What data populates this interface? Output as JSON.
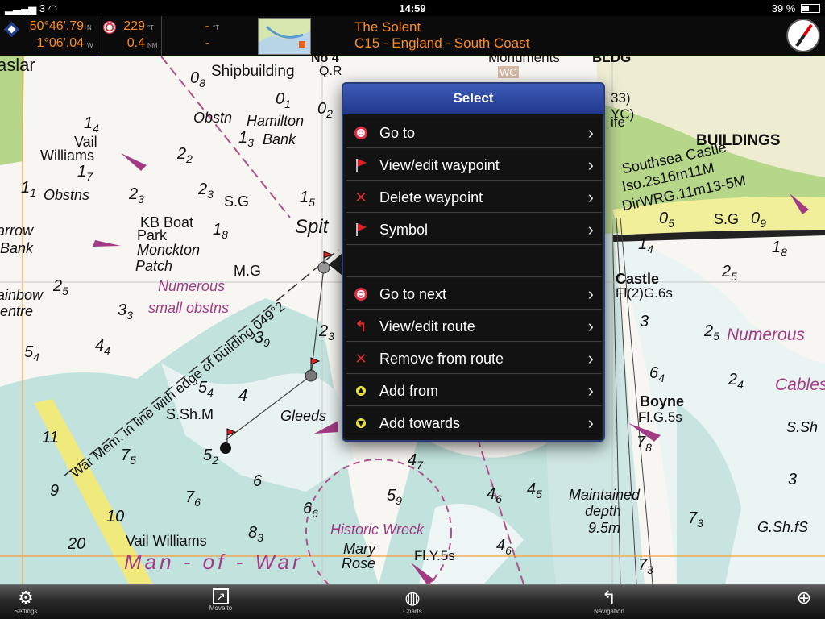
{
  "status_bar": {
    "carrier": "3",
    "time": "14:59",
    "battery": "39 %"
  },
  "info_bar": {
    "lat": "50°46'.79",
    "lat_hem": "N",
    "lon": "1°06'.04",
    "lon_hem": "W",
    "bearing": "229",
    "bearing_unit": "°T",
    "distance": "0.4",
    "distance_unit": "NM",
    "field3_top": "-",
    "field3_top_unit": "°T",
    "field3_bottom": "-",
    "chart_name": "The Solent",
    "chart_code": "C15 - England - South Coast"
  },
  "popup": {
    "title": "Select",
    "items": [
      {
        "label": "Go to",
        "icon": "target-icon"
      },
      {
        "label": "View/edit waypoint",
        "icon": "flag-icon"
      },
      {
        "label": "Delete waypoint",
        "icon": "x-icon"
      },
      {
        "label": "Symbol",
        "icon": "flag-icon"
      },
      {
        "label": "",
        "icon": ""
      },
      {
        "label": "Go to next",
        "icon": "target-icon"
      },
      {
        "label": "View/edit route",
        "icon": "route-icon"
      },
      {
        "label": "Remove from route",
        "icon": "x-icon"
      },
      {
        "label": "Add from",
        "icon": "triangle-up-icon"
      },
      {
        "label": "Add towards",
        "icon": "triangle-down-icon"
      }
    ]
  },
  "chart_labels": {
    "haslar": "aslar",
    "shipbuilding": "Shipbuilding",
    "no4": "No 4",
    "qr": "Q.R",
    "monuments": "Monuments",
    "bldg": "BLDG",
    "wc": "WC",
    "vail_williams_1": "Vail",
    "vail_williams_2": "Williams",
    "obstn1": "Obstn",
    "hamilton": "Hamilton",
    "bank": "Bank",
    "obstns": "Obstns",
    "kb1": "KB Boat",
    "kb2": "Park",
    "monck1": "Monckton",
    "monck2": "Patch",
    "arrow_bank_1": "arrow",
    "arrow_bank_2": "Bank",
    "rainbow_1": "ainbow",
    "rainbow_2": "entre",
    "spit": "Spit",
    "sg": "S.G",
    "mg": "M.G",
    "numerous1": "Numerous",
    "numerous2": "small obstns",
    "transit": "War Mem. in line with edge of building 049°2",
    "ssh": "S.Sh.M",
    "gleeds": "Gleeds",
    "vail2": "Vail Williams",
    "man_of_war": "Man - of - War",
    "mary1": "Mary",
    "mary2": "Rose",
    "historic": "Historic Wreck",
    "fly": "Fl.Y.5s",
    "buildings": "BUILDINGS",
    "southsea1": "Southsea Castle",
    "southsea2": "Iso.2s16m11M",
    "southsea3": "DirWRG.11m13-5M",
    "sg2": "S.G",
    "castle": "Castle",
    "fl2g": "Fl(2)G.6s",
    "numerous3": "Numerous",
    "cables": "Cables",
    "boyne": "Boyne",
    "flg5": "Fl.G.5s",
    "ssh2": "S.Sh",
    "maintained1": "Maintained",
    "maintained2": "depth",
    "maintained3": "9.5m",
    "gshfs": "G.Sh.fS",
    "life": "ife",
    "yc": "YC)",
    "n33": "33)"
  },
  "toolbar": {
    "settings": "Settings",
    "move_to": "Move to",
    "charts": "Charts",
    "navigation": "Navigation"
  },
  "colors": {
    "accent": "#ff8c1a",
    "popup_header": "#2f4aa8",
    "land": "#f2f0a0",
    "green": "#b8d88c",
    "water_shallow": "#bfe0dc"
  }
}
